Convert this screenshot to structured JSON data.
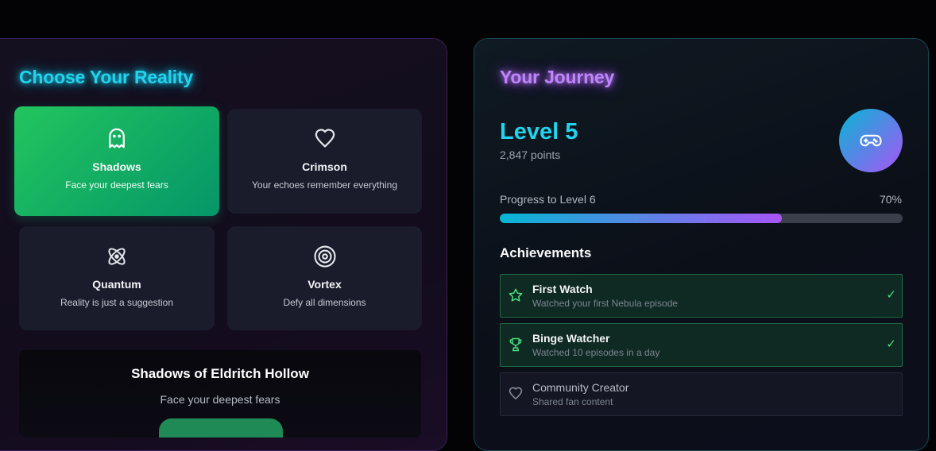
{
  "left_panel": {
    "title": "Choose Your Reality",
    "realities": [
      {
        "name": "Shadows",
        "desc": "Face your deepest fears",
        "icon": "ghost-icon",
        "active": true
      },
      {
        "name": "Crimson",
        "desc": "Your echoes remember everything",
        "icon": "heart-icon",
        "active": false
      },
      {
        "name": "Quantum",
        "desc": "Reality is just a suggestion",
        "icon": "atom-icon",
        "active": false
      },
      {
        "name": "Vortex",
        "desc": "Defy all dimensions",
        "icon": "target-icon",
        "active": false
      }
    ],
    "featured": {
      "title": "Shadows of Eldritch Hollow",
      "subtitle": "Face your deepest fears"
    }
  },
  "right_panel": {
    "title": "Your Journey",
    "level": "Level 5",
    "points": "2,847 points",
    "avatar_icon": "gamepad-icon",
    "progress": {
      "label": "Progress to Level 6",
      "percent_text": "70%",
      "value": 0.7
    },
    "achievements_title": "Achievements",
    "achievements": [
      {
        "name": "First Watch",
        "desc": "Watched your first Nebula episode",
        "icon": "star-icon",
        "done": true,
        "check": "✓"
      },
      {
        "name": "Binge Watcher",
        "desc": "Watched 10 episodes in a day",
        "icon": "trophy-icon",
        "done": true,
        "check": "✓"
      },
      {
        "name": "Community Creator",
        "desc": "Shared fan content",
        "icon": "heart-icon",
        "done": false,
        "check": ""
      }
    ]
  },
  "colors": {
    "cyan": "#22d3ee",
    "purple": "#c084fc",
    "active_green": "#22c55e",
    "done_green": "#4ade80"
  }
}
